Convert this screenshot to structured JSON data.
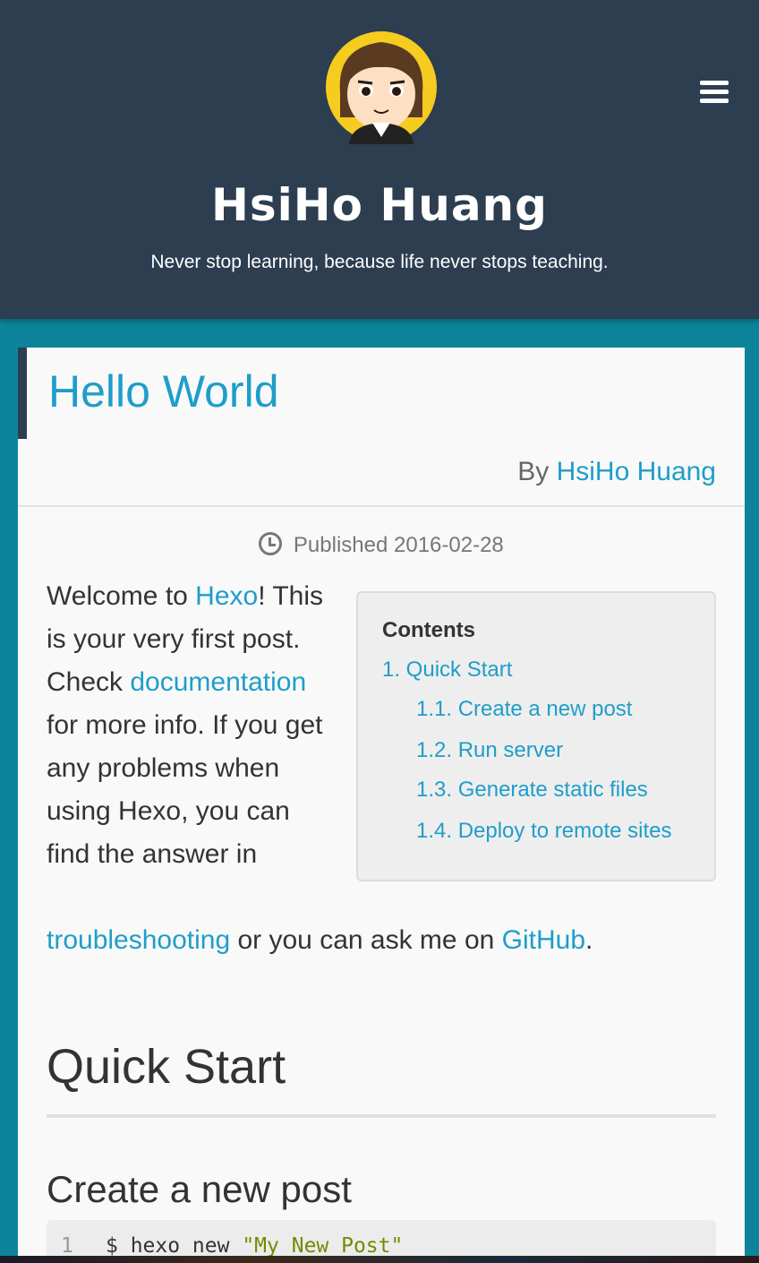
{
  "header": {
    "site_title": "HsiHo Huang",
    "subtitle": "Never stop learning, because life never stops teaching.",
    "avatar_icon": "avatar-girl-icon",
    "menu_icon": "hamburger-menu-icon",
    "background_color": "#2c3e50"
  },
  "post": {
    "title": "Hello World",
    "byline_prefix": "By",
    "author": "HsiHo Huang",
    "published_label": "Published",
    "published_date": "2016-02-28",
    "accent_color": "#1e9ec9"
  },
  "intro": {
    "t1": "Welcome to ",
    "hexo_link": "Hexo",
    "t2": "! This is your very first post. Check ",
    "docs_link": "documentation",
    "t3": " for more info. If you get any problems when using Hexo, you can find the answer in",
    "troubleshooting_link": "troubleshooting",
    "t4": " or you can ask me on ",
    "github_link": "GitHub",
    "t5": "."
  },
  "toc": {
    "title": "Contents",
    "items": [
      "1. Quick Start",
      "1.1. Create a new post",
      "1.2. Run server",
      "1.3. Generate static files",
      "1.4. Deploy to remote sites"
    ]
  },
  "sections": {
    "quick_start": "Quick Start",
    "create_post": "Create a new post"
  },
  "code": {
    "line_number": "1",
    "command": "$ hexo new ",
    "argument": "\"My New Post\""
  }
}
